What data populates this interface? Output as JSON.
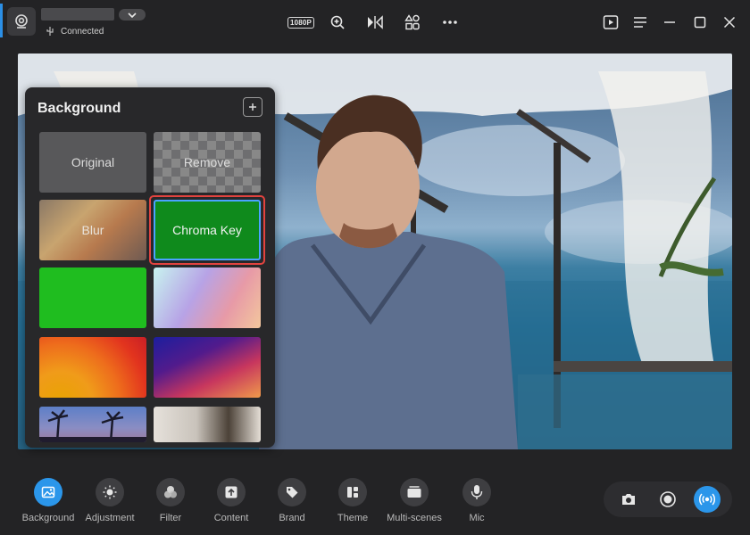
{
  "header": {
    "status_text": "Connected",
    "resolution_label": "1080P",
    "icons": [
      "webcam-icon",
      "usb-icon",
      "chevron-down-icon",
      "zoom-in-icon",
      "mirror-icon",
      "widgets-icon",
      "more-icon",
      "play-icon",
      "menu-icon",
      "minimize-icon",
      "maximize-icon",
      "close-icon"
    ]
  },
  "panel": {
    "title": "Background",
    "tiles": [
      {
        "label": "Original"
      },
      {
        "label": "Remove"
      },
      {
        "label": "Blur"
      },
      {
        "label": "Chroma Key",
        "selected": true
      },
      {
        "label": ""
      },
      {
        "label": ""
      },
      {
        "label": ""
      },
      {
        "label": ""
      },
      {
        "label": ""
      },
      {
        "label": ""
      }
    ]
  },
  "toolbar": {
    "items": [
      {
        "label": "Background",
        "icon": "image-icon",
        "active": true
      },
      {
        "label": "Adjustment",
        "icon": "brightness-icon"
      },
      {
        "label": "Filter",
        "icon": "filter-icon"
      },
      {
        "label": "Content",
        "icon": "upload-icon"
      },
      {
        "label": "Brand",
        "icon": "tag-icon"
      },
      {
        "label": "Theme",
        "icon": "theme-icon"
      },
      {
        "label": "Multi-scenes",
        "icon": "scenes-icon"
      },
      {
        "label": "Mic",
        "icon": "mic-icon"
      }
    ]
  },
  "capture": {
    "icons": [
      "camera-icon",
      "record-icon",
      "live-broadcast-icon"
    ]
  },
  "colors": {
    "accent": "#2b96ea",
    "chroma_green": "#0f8a1c",
    "selection_ring": "#e2433f"
  }
}
